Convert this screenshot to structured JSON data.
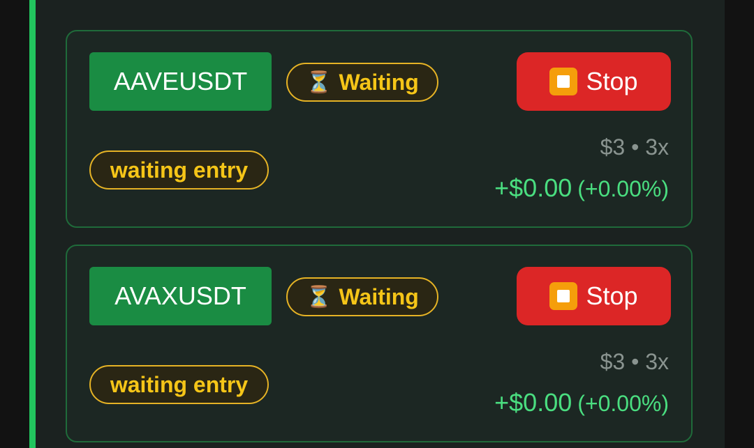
{
  "cards": [
    {
      "symbol": "AAVEUSDT",
      "status_icon": "⏳",
      "status_label": "Waiting",
      "stop_label": "Stop",
      "entry_status": "waiting entry",
      "meta": "$3 • 3x",
      "pnl_value": "+$0.00",
      "pnl_percent": "(+0.00%)"
    },
    {
      "symbol": "AVAXUSDT",
      "status_icon": "⏳",
      "status_label": "Waiting",
      "stop_label": "Stop",
      "entry_status": "waiting entry",
      "meta": "$3 • 3x",
      "pnl_value": "+$0.00",
      "pnl_percent": "(+0.00%)"
    }
  ],
  "colors": {
    "accent": "#22c55e",
    "symbol_bg": "#1a8c43",
    "stop_bg": "#dc2626",
    "waiting": "#f5c518",
    "pnl": "#4ade80"
  },
  "icons": {
    "status": "hourglass-icon",
    "stop": "stop-square-icon"
  }
}
